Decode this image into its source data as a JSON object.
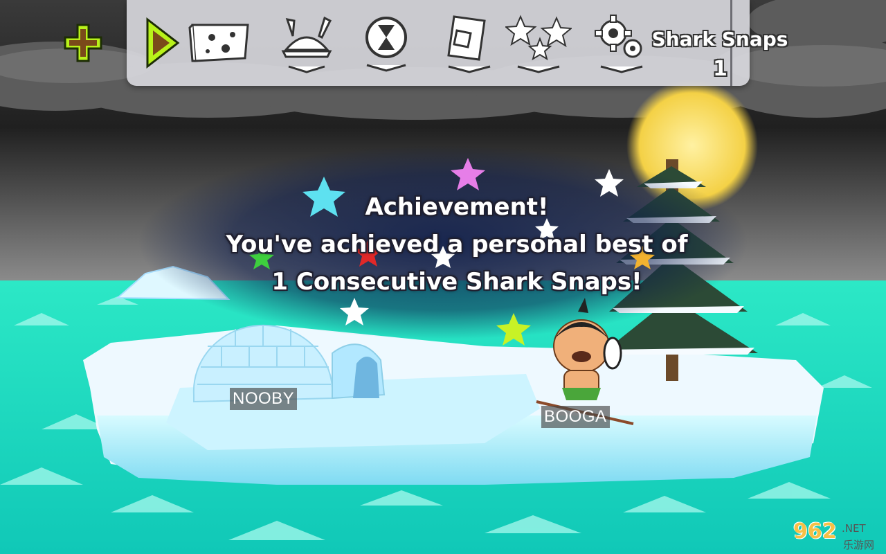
{
  "toolbar": {
    "icons": [
      "add-icon",
      "play-icon",
      "map-icon",
      "hat-icon",
      "hourglass-icon",
      "card-icon",
      "stars-icon",
      "settings-icon"
    ],
    "counter_label": "Shark Snaps",
    "counter_value": "1"
  },
  "achievement": {
    "line1": "Achievement!",
    "line2": "You've achieved a personal best of",
    "line3": "1 Consecutive Shark Snaps!"
  },
  "characters": {
    "nooby": "NOOBY",
    "booga": "BOOGA"
  },
  "watermark": {
    "brand": "962",
    "suffix": ".NET",
    "cn": "乐游网"
  },
  "colors": {
    "sea": "#18e0bf",
    "ice": "#bdf3ff",
    "sky": "#2a2a2a",
    "moon": "#f5d447",
    "toolbar": "#d7d7dc",
    "accent_green": "#b8f21a"
  }
}
